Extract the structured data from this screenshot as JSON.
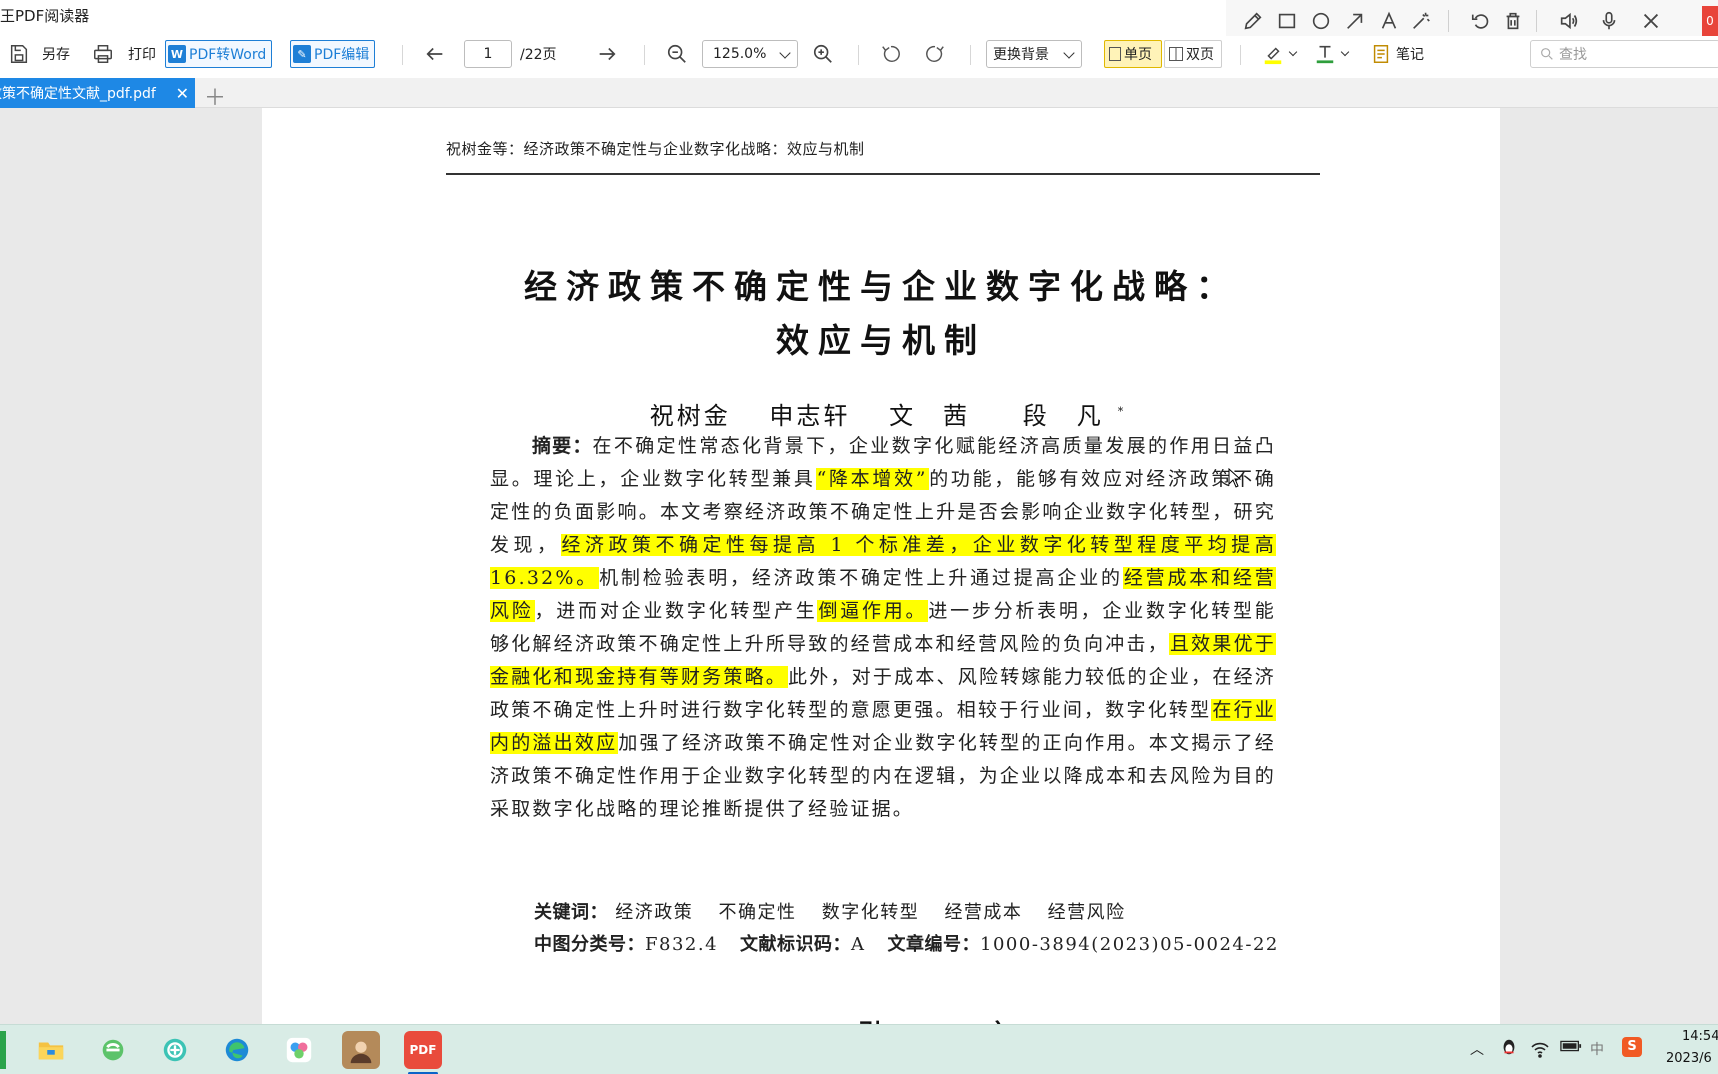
{
  "app": {
    "title": "王PDF阅读器"
  },
  "toolbar": {
    "save_as_label": "另存",
    "print_label": "打印",
    "pdf_to_word_label": "PDF转Word",
    "pdf_edit_label": "PDF编辑",
    "current_page": "1",
    "total_pages": "/22页",
    "zoom": "125.0%",
    "background_label": "更换背景",
    "single_page_label": "单页",
    "double_page_label": "双页",
    "notes_label": "笔记",
    "search_placeholder": "查找",
    "highlight_color": "#ffff00",
    "text_color": "#2e9e3c"
  },
  "tabs": [
    {
      "label": "政策不确定性文献_pdf.pdf",
      "active": true
    }
  ],
  "document": {
    "running_header": "祝树金等：经济政策不确定性与企业数字化战略：效应与机制",
    "title_line1": "经济政策不确定性与企业数字化战略：",
    "title_line2": "效应与机制",
    "authors": [
      "祝树金",
      "申志轩",
      "文　茜",
      "段　凡"
    ],
    "author_mark": "*",
    "abstract_label": "摘要：",
    "abstract_segments": [
      {
        "text": "在不确定性常态化背景下，企业数字化赋能经济高质量发展的作用日益凸显。理论上，企业数字化转型兼具",
        "highlight": false
      },
      {
        "text": "“降本增效”",
        "highlight": true
      },
      {
        "text": "的功能，能够有效应对经济政策不确定性的负面影响。本文考察经济政策不确定性上升是否会影响企业数字化转型，研究发现，",
        "highlight": false
      },
      {
        "text": "经济政策不确定性每提高 1 个标准差，企业数字化转型程度平均提高 16.32%。",
        "highlight": true
      },
      {
        "text": "机制检验表明，经济政策不确定性上升通过提高企业的",
        "highlight": false
      },
      {
        "text": "经营成本和经营风险",
        "highlight": true
      },
      {
        "text": "，进而对企业数字化转型产生",
        "highlight": false
      },
      {
        "text": "倒逼作用。",
        "highlight": true
      },
      {
        "text": "进一步分析表明，企业数字化转型能够化解经济政策不确定性上升所导致的经营成本和经营风险的负向冲击，",
        "highlight": false
      },
      {
        "text": "且效果优于金融化和现金持有等财务策略。",
        "highlight": true
      },
      {
        "text": "此外，对于成本、风险转嫁能力较低的企业，在经济政策不确定性上升时进行数字化转型的意愿更强。相较于行业间，数字化转型",
        "highlight": false
      },
      {
        "text": "在行业内的溢出效应",
        "highlight": true
      },
      {
        "text": "加强了经济政策不确定性对企业数字化转型的正向作用。本文揭示了经济政策不确定性作用于企业数字化转型的内在逻辑，为企业以降成本和去风险为目的采取数字化战略的理论推断提供了经验证据。",
        "highlight": false
      }
    ],
    "keywords_label": "关键词：",
    "keywords": [
      "经济政策",
      "不确定性",
      "数字化转型",
      "经营成本",
      "经营风险"
    ],
    "clc_label": "中图分类号：",
    "clc_value": "F832.4",
    "doc_code_label": "文献标识码：",
    "doc_code_value": "A",
    "article_no_label": "文章编号：",
    "article_no_value": "1000-3894(2023)05-0024-22",
    "section_start": "引　言"
  },
  "taskbar": {
    "tray_ime": "中",
    "clock_time": "14:54",
    "clock_date": "2023/6"
  }
}
